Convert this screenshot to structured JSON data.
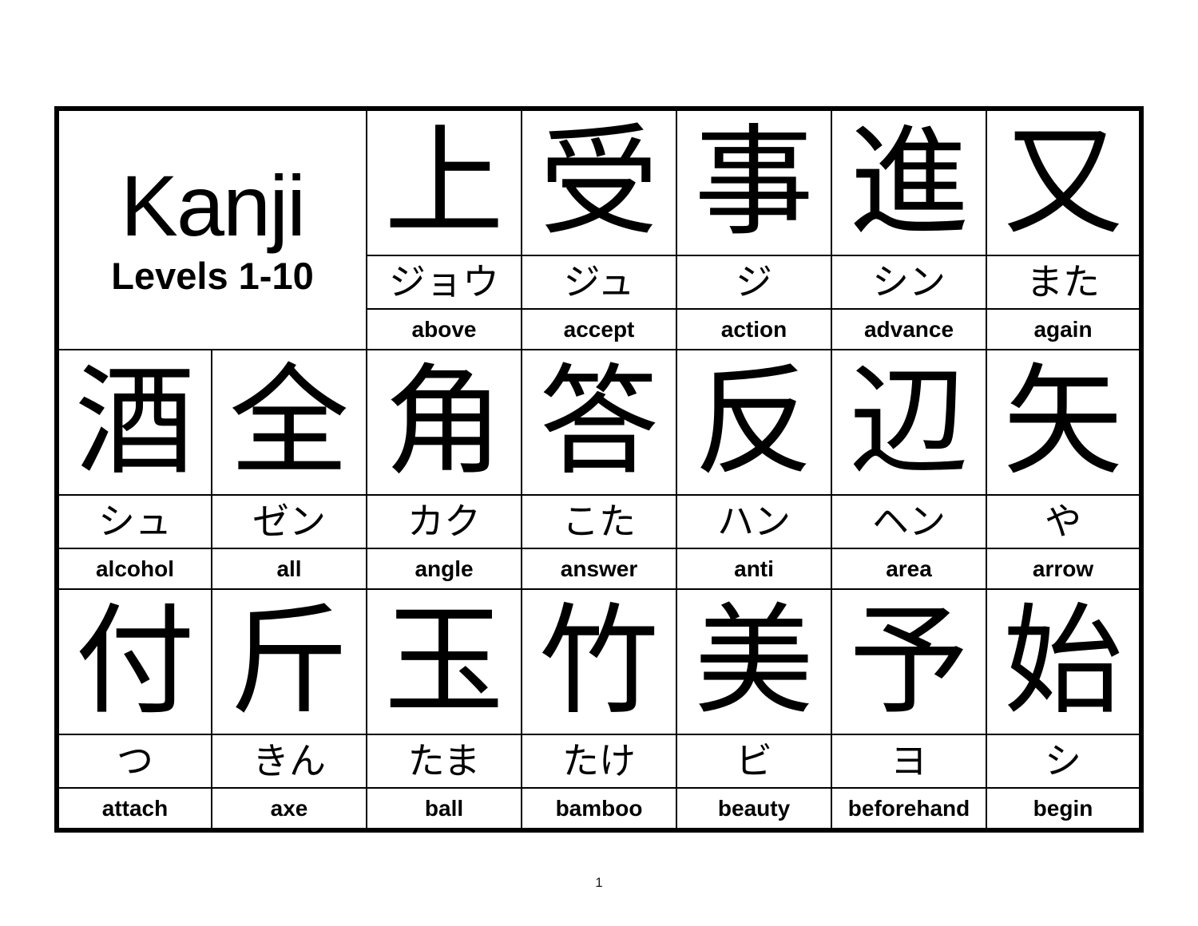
{
  "document": {
    "title_main": "Kanji",
    "title_sub": "Levels 1-10",
    "page_number": "1"
  },
  "columns_per_row": 7,
  "rows": [
    {
      "has_title_cell": true,
      "title_colspan": 2,
      "entries": [
        {
          "kanji": "上",
          "reading": "ジョウ",
          "meaning": "above"
        },
        {
          "kanji": "受",
          "reading": "ジュ",
          "meaning": "accept"
        },
        {
          "kanji": "事",
          "reading": "ジ",
          "meaning": "action"
        },
        {
          "kanji": "進",
          "reading": "シン",
          "meaning": "advance"
        },
        {
          "kanji": "又",
          "reading": "また",
          "meaning": "again"
        }
      ]
    },
    {
      "has_title_cell": false,
      "entries": [
        {
          "kanji": "酒",
          "reading": "シュ",
          "meaning": "alcohol"
        },
        {
          "kanji": "全",
          "reading": "ゼン",
          "meaning": "all"
        },
        {
          "kanji": "角",
          "reading": "カク",
          "meaning": "angle"
        },
        {
          "kanji": "答",
          "reading": "こた",
          "meaning": "answer"
        },
        {
          "kanji": "反",
          "reading": "ハン",
          "meaning": "anti"
        },
        {
          "kanji": "辺",
          "reading": "ヘン",
          "meaning": "area"
        },
        {
          "kanji": "矢",
          "reading": "や",
          "meaning": "arrow"
        }
      ]
    },
    {
      "has_title_cell": false,
      "entries": [
        {
          "kanji": "付",
          "reading": "つ",
          "meaning": "attach"
        },
        {
          "kanji": "斤",
          "reading": "きん",
          "meaning": "axe"
        },
        {
          "kanji": "玉",
          "reading": "たま",
          "meaning": "ball"
        },
        {
          "kanji": "竹",
          "reading": "たけ",
          "meaning": "bamboo"
        },
        {
          "kanji": "美",
          "reading": "ビ",
          "meaning": "beauty"
        },
        {
          "kanji": "予",
          "reading": "ヨ",
          "meaning": "beforehand"
        },
        {
          "kanji": "始",
          "reading": "シ",
          "meaning": "begin"
        }
      ]
    }
  ],
  "colors": {
    "ink": "#000000",
    "paper": "#ffffff"
  }
}
